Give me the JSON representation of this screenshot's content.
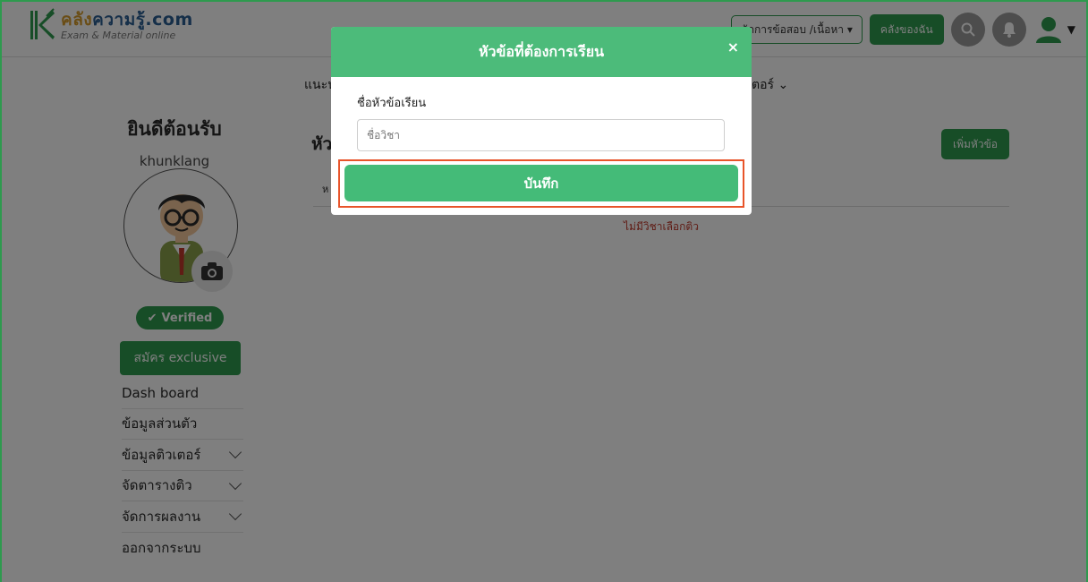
{
  "header": {
    "logo_name_part1": "คลัง",
    "logo_name_part2": "ความรู้.com",
    "logo_tagline": "Exam & Material online",
    "select_label": "จัดการข้อสอบ /เนื้อหา",
    "my_warehouse": "คลังของฉัน"
  },
  "page": {
    "nav_left": "แนะน",
    "nav_right": "ตอร์",
    "content_title": "หัว",
    "add_topic": "เพิ่มหัวข้อ",
    "table_header": "ห",
    "empty_message": "ไม่มีวิชาเลือกติว"
  },
  "sidebar": {
    "welcome": "ยินดีต้อนรับ",
    "username": "khunklang",
    "verified": "Verified",
    "exclusive": "สมัคร exclusive",
    "menu": [
      {
        "label": "Dash board",
        "has_chevron": false
      },
      {
        "label": "ข้อมูลส่วนตัว",
        "has_chevron": false
      },
      {
        "label": "ข้อมูลติวเตอร์",
        "has_chevron": true
      },
      {
        "label": "จัดตารางติว",
        "has_chevron": true
      },
      {
        "label": "จัดการผลงาน",
        "has_chevron": true
      },
      {
        "label": "ออกจากระบบ",
        "has_chevron": false
      }
    ]
  },
  "modal": {
    "title": "หัวข้อที่ต้องการเรียน",
    "close": "×",
    "field_label": "ชื่อหัวข้อเรียน",
    "field_placeholder": "ชื่อวิชา",
    "field_value": "",
    "save_label": "บันทึก"
  },
  "colors": {
    "brand_green": "#2e9a4e",
    "modal_header": "#4cbb7a",
    "save_button": "#44bb78",
    "highlight": "#e8542a"
  }
}
